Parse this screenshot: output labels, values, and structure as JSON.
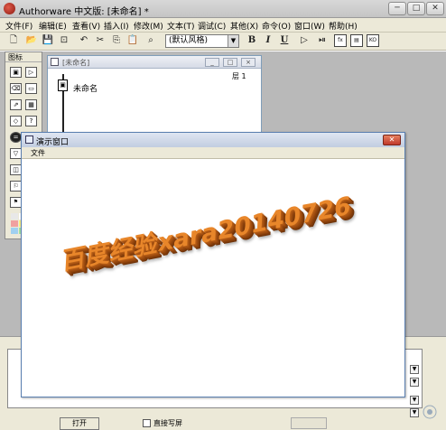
{
  "window": {
    "title": "Authorware 中文版: [未命名] *",
    "controls": [
      "─",
      "□",
      "✕"
    ]
  },
  "menubar": [
    "文件(F)",
    "编辑(E)",
    "查看(V)",
    "插入(I)",
    "修改(M)",
    "文本(T)",
    "调试(C)",
    "其他(X)",
    "命令(O)",
    "窗口(W)",
    "帮助(H)"
  ],
  "toolbar": {
    "style_select": "(默认风格)",
    "bold": "B",
    "italic": "I",
    "underline": "U"
  },
  "palette": {
    "title": "图标"
  },
  "flow_window": {
    "title": "[未命名]",
    "layer": "层 1",
    "icon_label": "未命名"
  },
  "presentation_window": {
    "title": "演示窗口",
    "menu_file": "文件",
    "display_text": "百度经验xara20140726",
    "text_color": "#e8862a"
  },
  "properties": {
    "button_label": "打开",
    "checkbox_label": "直接写屏"
  }
}
